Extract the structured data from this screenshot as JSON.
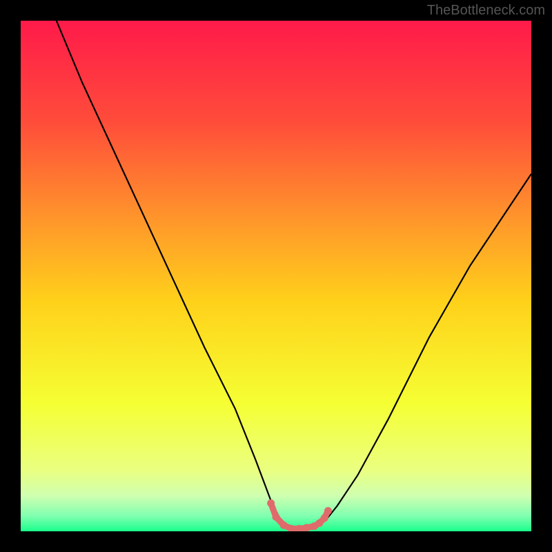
{
  "watermark": "TheBottleneck.com",
  "chart_data": {
    "type": "line",
    "title": "",
    "xlabel": "",
    "ylabel": "",
    "xlim": [
      0,
      100
    ],
    "ylim": [
      0,
      100
    ],
    "gradient_stops": [
      {
        "offset": 0,
        "color": "#ff1a4a"
      },
      {
        "offset": 20,
        "color": "#ff4d3a"
      },
      {
        "offset": 40,
        "color": "#ff9a2a"
      },
      {
        "offset": 55,
        "color": "#ffd11a"
      },
      {
        "offset": 75,
        "color": "#f5ff33"
      },
      {
        "offset": 88,
        "color": "#eaff80"
      },
      {
        "offset": 93,
        "color": "#d0ffb0"
      },
      {
        "offset": 97,
        "color": "#80ffb0"
      },
      {
        "offset": 100,
        "color": "#1aff8c"
      }
    ],
    "series": [
      {
        "name": "bottleneck-curve",
        "color": "#000000",
        "x": [
          7,
          12,
          18,
          24,
          30,
          36,
          42,
          46,
          49,
          51,
          53,
          55,
          58,
          60,
          62,
          66,
          72,
          80,
          88,
          96,
          100
        ],
        "y": [
          100,
          88,
          75,
          62,
          49,
          36,
          24,
          14,
          6,
          2,
          0.5,
          0.5,
          1,
          2.5,
          5,
          11,
          22,
          38,
          52,
          64,
          70
        ]
      }
    ],
    "highlight": {
      "name": "optimal-zone",
      "color": "#e06b6b",
      "x": [
        49,
        50,
        51.5,
        53,
        54.5,
        56,
        57.5,
        58.5,
        59.5,
        60.2
      ],
      "y": [
        5.5,
        2.8,
        1.2,
        0.5,
        0.5,
        0.7,
        1.0,
        1.6,
        2.6,
        4.0
      ]
    }
  }
}
